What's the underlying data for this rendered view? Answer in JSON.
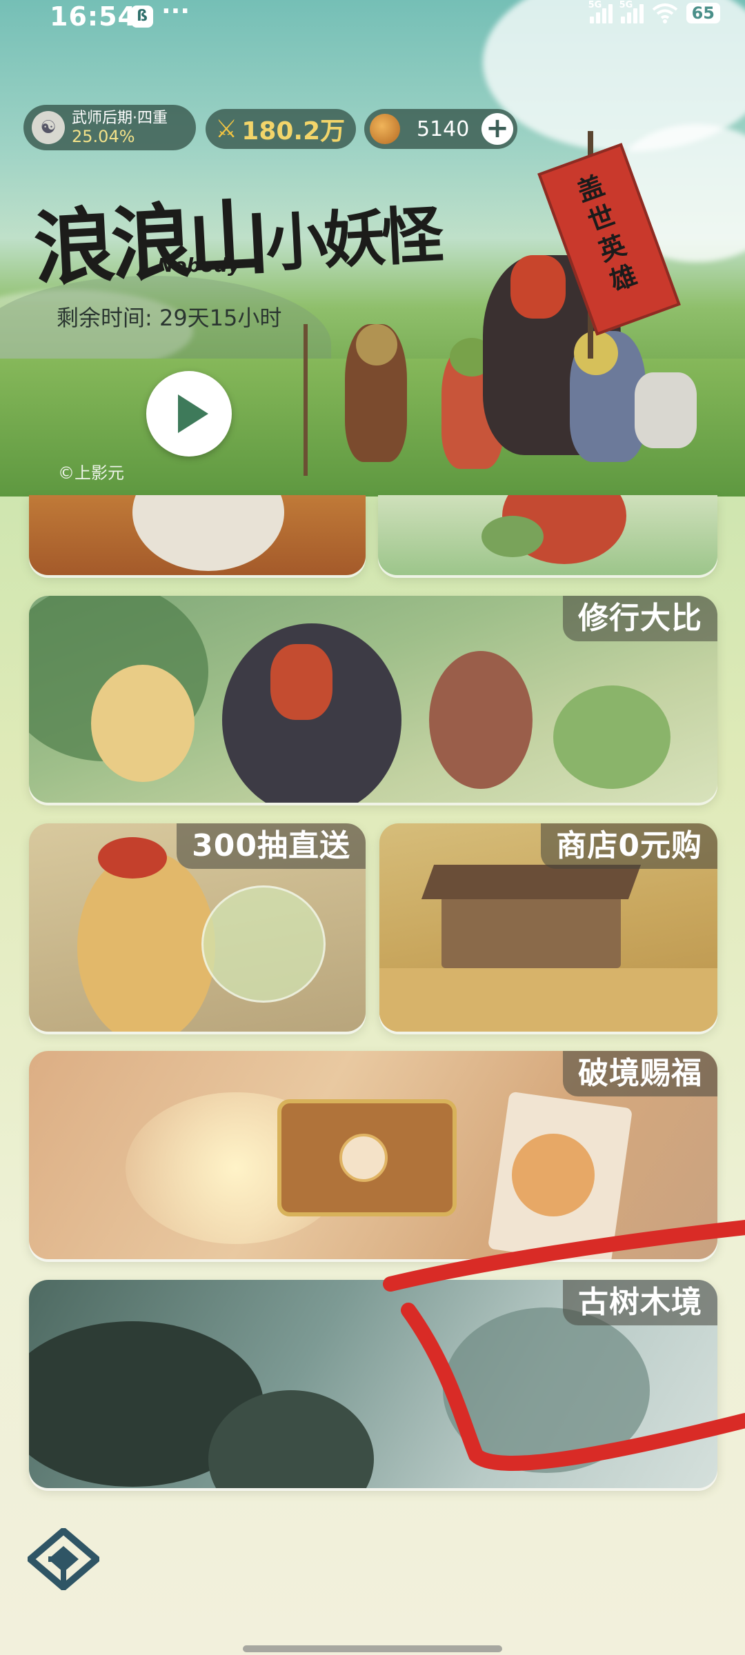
{
  "status_bar": {
    "time": "16:54",
    "app_badge": "ß",
    "dots": "···",
    "signal1_tag": "5G",
    "signal2_tag": "5G",
    "battery": "65"
  },
  "header": {
    "rank_name": "武师后期·四重",
    "rank_progress": "25.04%",
    "power": "180.2万",
    "currency": "5140",
    "plus_label": "+"
  },
  "hero": {
    "title_part1": "浪浪山",
    "title_en": "Nobody",
    "title_part2": "小妖怪",
    "banner_text": "盖世英雄",
    "time_left": "剩余时间: 29天15小时",
    "copyright": "©上影元"
  },
  "cards": [
    {
      "label": "修行大比"
    },
    {
      "label": "300抽直送"
    },
    {
      "label": "商店0元购"
    },
    {
      "label": "破境赐福"
    },
    {
      "label": "古树木境"
    }
  ],
  "colors": {
    "chip_bg": "#36544a",
    "accent_gold": "#f3d56a",
    "label_bg": "#46463c",
    "annotation_red": "#d92b26"
  },
  "icons": {
    "play": "play-icon",
    "plus": "plus-icon",
    "power": "sword-icon",
    "currency": "jade-icon",
    "logo": "app-logo-icon"
  }
}
